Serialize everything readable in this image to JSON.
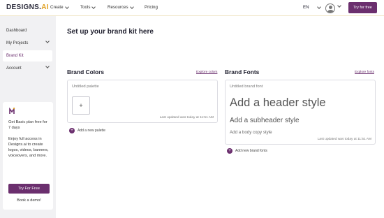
{
  "header": {
    "logo_text": "DESIGNS.",
    "logo_accent": "AI",
    "nav": [
      {
        "label": "Create"
      },
      {
        "label": "Tools"
      },
      {
        "label": "Resources"
      },
      {
        "label": "Pricing"
      }
    ],
    "language": "EN",
    "try_free_label": "Try for free"
  },
  "sidebar": {
    "items": [
      {
        "label": "Dashboard"
      },
      {
        "label": "My Projects"
      },
      {
        "label": "Brand Kit"
      },
      {
        "label": "Account"
      }
    ],
    "promo": {
      "title": "Get Basic plan free for 7 days",
      "text": "Enjoy full access in Designs.ai to create logos, videos, banners, voiceovers, and more.",
      "button_label": "Try For Free",
      "demo_label": "Book a demo!"
    }
  },
  "main": {
    "page_title": "Set up your brand kit here",
    "brand_colors": {
      "title": "Brand Colors",
      "explore_label": "Explore colors",
      "palette_name": "Untitled palette",
      "plus_glyph": "+",
      "updated_text": "Last updated was today at 11:51 AM",
      "add_label": "Add a new palette"
    },
    "brand_fonts": {
      "title": "Brand Fonts",
      "explore_label": "Explore fonts",
      "font_name": "Untitled brand font",
      "header_style": "Add a header style",
      "subheader_style": "Add a subheader style",
      "body_style": "Add a body copy style",
      "updated_text": "Last updated was today at 11:51 AM",
      "add_label": "Add new brand fonts"
    }
  },
  "colors": {
    "brand_purple": "#6b2f6e",
    "accent_orange": "#e0a020",
    "sidebar_bg": "#f1f1f3"
  }
}
